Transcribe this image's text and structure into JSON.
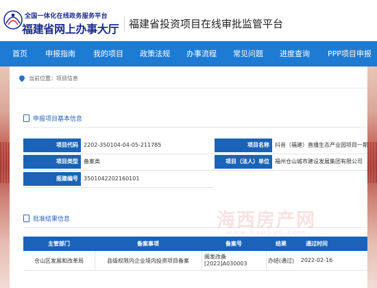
{
  "header": {
    "site_sub": "全国一体化在线政务服务平台",
    "site_name": "福建省网上办事大厅",
    "platform_title": "福建省投资项目在线审批监管平台"
  },
  "nav": {
    "items": [
      "首页",
      "申报指南",
      "我的项目",
      "政策法规",
      "办事流程",
      "常见问题",
      "进度查询",
      "PPP项目申报"
    ]
  },
  "breadcrumb": {
    "prefix": "当前位置：",
    "current": "项目信息"
  },
  "project_section": {
    "title": "申报项目基本信息",
    "fields": {
      "code_label": "项目代码",
      "code_value": "2202-350104-04-05-211785",
      "name_label": "项目名称",
      "name_value": "抖音（福建）直播生态产业园项目一期",
      "type_label": "项目类型",
      "type_value": "备案类",
      "owner_label": "项目（法人）单位",
      "owner_value": "福州仓山城市建设发展集团有限公司",
      "report_label": "报建编号",
      "report_value": "3501042202160101"
    }
  },
  "approval_section": {
    "title": "批准结果信息",
    "headers": [
      "主管部门",
      "备案事项",
      "备案号",
      "结果",
      "通过时间"
    ],
    "rows": [
      {
        "department": "仓山区发展和改革局",
        "item": "县级权限内企业境内投资项目备案",
        "number_line1": "闽发改备",
        "number_line2": "[2022]A030003",
        "result": "办结(通过)",
        "time": "2022-02-16"
      }
    ]
  },
  "watermark": {
    "text": "海西房产网",
    "sub": "www.hx0590.com"
  }
}
